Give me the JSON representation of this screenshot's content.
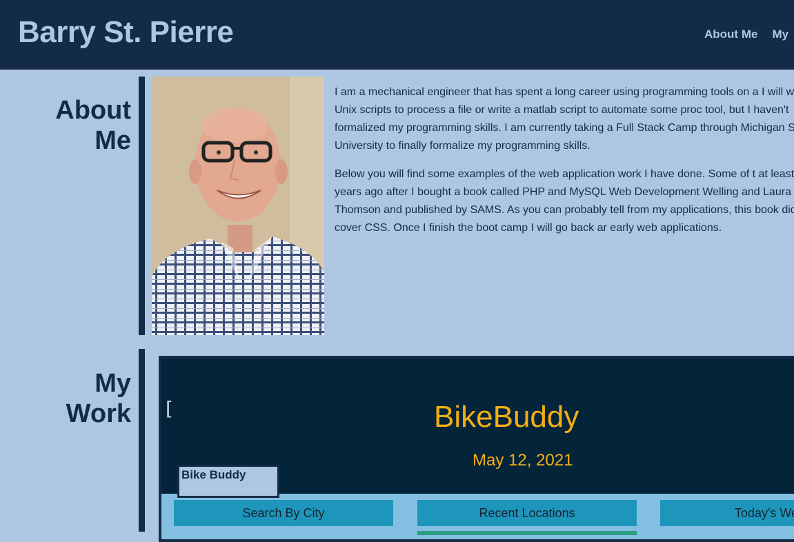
{
  "header": {
    "site_title": "Barry St. Pierre",
    "nav": [
      "About Me",
      "My"
    ]
  },
  "about": {
    "title_line1": "About",
    "title_line2": "Me",
    "paragraphs": [
      "I am a mechanical engineer that has spent a long career using programming tools on a I will write Unix scripts to process a file or write a matlab script to automate some proc tool, but I haven't formalized my programming skills. I am currently taking a Full Stack Camp through Michigan State University to finally formalize my programming skills.",
      "Below you will find some examples of the web application work I have done. Some of t at least five years ago after I bought a book called PHP and MySQL Web Development Welling and Laura Thomson and published by SAMS. As you can probably tell from my applications, this book did not cover CSS. Once I finish the boot camp I will go back ar early web applications."
    ]
  },
  "work": {
    "title_line1": "My",
    "title_line2": "Work",
    "card": {
      "label": "Bike Buddy",
      "screenshot": {
        "bracket": "[",
        "app_title": "BikeBuddy",
        "date": "May 12, 2021",
        "tabs": [
          "Search By City",
          "Recent Locations",
          "Today's Wea"
        ]
      }
    }
  },
  "colors": {
    "navy": "#142b47",
    "light_blue": "#adc7e2",
    "accent_gold": "#f3ae13",
    "teal": "#1e96bb"
  }
}
